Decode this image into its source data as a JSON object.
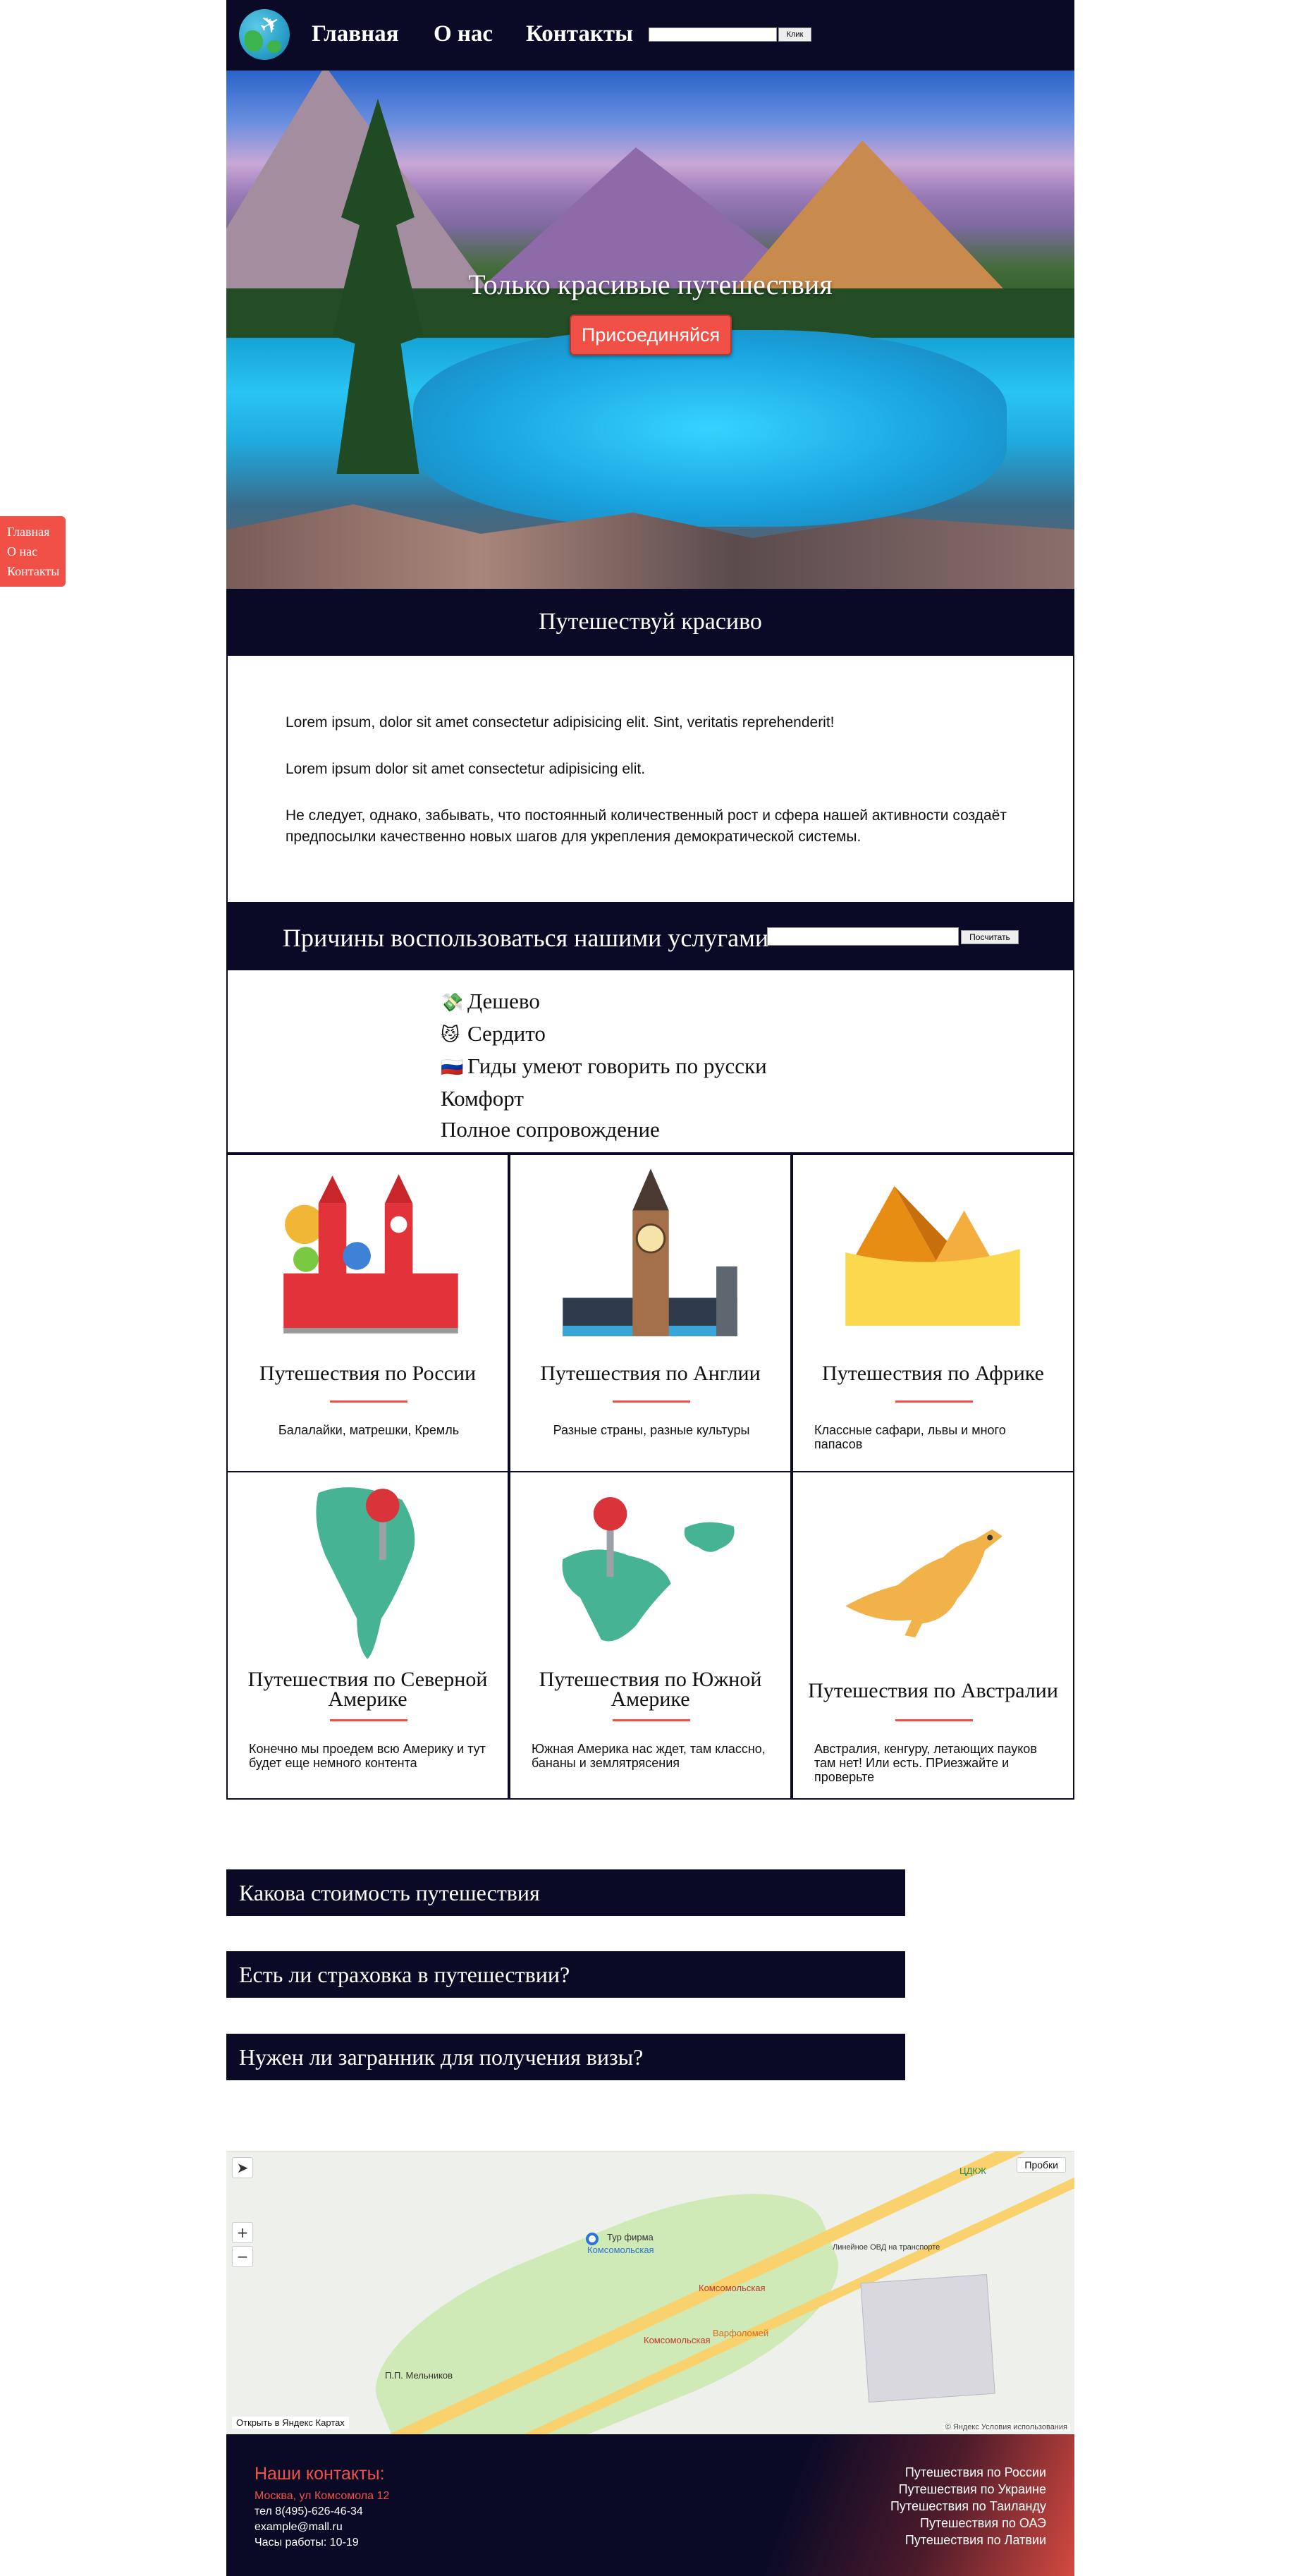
{
  "header": {
    "nav": [
      "Главная",
      "О нас",
      "Контакты"
    ],
    "search_button": "Клик"
  },
  "hero": {
    "title": "Только красивые путешествия",
    "button": "Присоединяйся"
  },
  "side_menu": [
    "Главная",
    "О нас",
    "Контакты"
  ],
  "about": {
    "title": "Путешествуй красиво",
    "paragraphs": [
      "Lorem ipsum, dolor sit amet consectetur adipisicing elit. Sint, veritatis reprehenderit!",
      "Lorem ipsum dolor sit amet consectetur adipisicing elit.",
      "Не следует, однако, забывать, что постоянный количественный рост и сфера нашей активности создаёт предпосылки качественно новых шагов для укрепления демократической системы."
    ]
  },
  "reasons": {
    "title": "Причины воспользоваться нашими услугами",
    "count_button": "Посчитать",
    "items": [
      {
        "icon": "money-icon",
        "emoji": "💸",
        "label": "Дешево"
      },
      {
        "icon": "cat-icon",
        "emoji": "😼",
        "label": "Сердито"
      },
      {
        "icon": "russia-flag-icon",
        "emoji": "🇷🇺",
        "label": "Гиды умеют говорить по русски"
      },
      {
        "icon": "",
        "emoji": "",
        "label": "Комфорт"
      },
      {
        "icon": "",
        "emoji": "",
        "label": "Полное сопровождение"
      }
    ]
  },
  "cards": [
    {
      "title": "Путешествия по России",
      "desc": "Балалайки, матрешки, Кремль",
      "icon": "kremlin-icon"
    },
    {
      "title": "Путешествия по Англии",
      "desc": "Разные страны, разные культуры",
      "icon": "big-ben-icon"
    },
    {
      "title": "Путешествия по Африке",
      "desc": "Классные сафари, львы и много папасов",
      "icon": "pyramids-icon"
    },
    {
      "title": "Путешествия по Северной Америке",
      "desc": "Конечно мы проедем всю Америку и тут будет еще немного контента",
      "icon": "south-america-map-icon"
    },
    {
      "title": "Путешествия по Южной Америке",
      "desc": "Южная Америка нас ждет, там классно, бананы и землятрясения",
      "icon": "north-america-map-icon"
    },
    {
      "title": "Путешествия по Австралии",
      "desc": "Австралия, кенгуру, летающих пауков там нет! Или есть. ПРиезжайте и проверьте",
      "icon": "kangaroo-icon"
    }
  ],
  "faq": [
    "Какова стоимость путешествия",
    "Есть ли страховка в путешествии?",
    "Нужен ли загранник для получения визы?"
  ],
  "map": {
    "traffic": "Пробки",
    "open_link": "Открыть в Яндекс Картах",
    "copyright": "© Яндекс Условия использования",
    "place": "Тур фирма",
    "place2": "Комсомольская",
    "labels": [
      "Комсомольская",
      "Комсомольская",
      "Варфоломей",
      "ЦДКЖ",
      "П.П. Мельников",
      "Линейное ОВД на транспорте"
    ]
  },
  "footer": {
    "title": "Наши контакты:",
    "address": "Москва, ул Комсомола 12",
    "lines": [
      "тел 8(495)-626-46-34",
      "example@mall.ru",
      "Часы работы: 10-19"
    ],
    "links": [
      "Путешествия по России",
      "Путешествия по Украине",
      "Путешествия по Таиланду",
      "Путешествия по ОАЭ",
      "Путешествия по Латвии"
    ]
  }
}
